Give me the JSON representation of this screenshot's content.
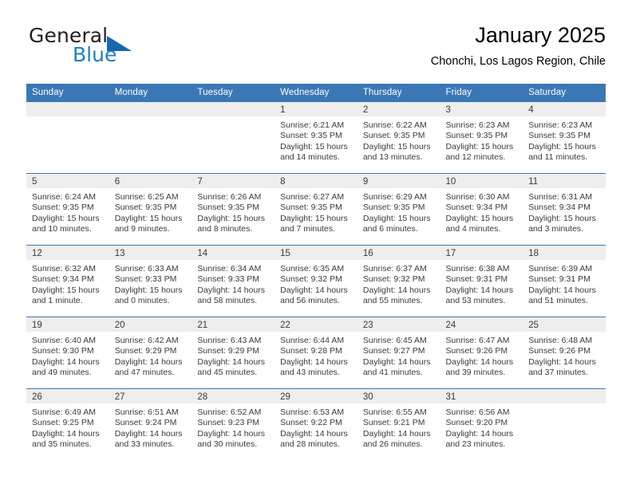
{
  "brand": {
    "name_part1": "General",
    "name_part2": "Blue",
    "triangle_color": "#1668b0",
    "blue_color": "#1f7fc4"
  },
  "header": {
    "title": "January 2025",
    "subtitle": "Chonchi, Los Lagos Region, Chile"
  },
  "theme": {
    "header_bg": "#3b77b5",
    "header_text": "#ffffff",
    "daynum_band_bg": "#eeeeee",
    "cell_text": "#3a3a3a",
    "row_border": "#3b77b5"
  },
  "weekday_headers": [
    "Sunday",
    "Monday",
    "Tuesday",
    "Wednesday",
    "Thursday",
    "Friday",
    "Saturday"
  ],
  "labels": {
    "sunrise_prefix": "Sunrise:",
    "sunset_prefix": "Sunset:",
    "daylight_prefix": "Daylight:"
  },
  "weeks": [
    [
      {
        "day": "",
        "sunrise": "",
        "sunset": "",
        "daylight": ""
      },
      {
        "day": "",
        "sunrise": "",
        "sunset": "",
        "daylight": ""
      },
      {
        "day": "",
        "sunrise": "",
        "sunset": "",
        "daylight": ""
      },
      {
        "day": "1",
        "sunrise": "Sunrise: 6:21 AM",
        "sunset": "Sunset: 9:35 PM",
        "daylight": "Daylight: 15 hours and 14 minutes."
      },
      {
        "day": "2",
        "sunrise": "Sunrise: 6:22 AM",
        "sunset": "Sunset: 9:35 PM",
        "daylight": "Daylight: 15 hours and 13 minutes."
      },
      {
        "day": "3",
        "sunrise": "Sunrise: 6:23 AM",
        "sunset": "Sunset: 9:35 PM",
        "daylight": "Daylight: 15 hours and 12 minutes."
      },
      {
        "day": "4",
        "sunrise": "Sunrise: 6:23 AM",
        "sunset": "Sunset: 9:35 PM",
        "daylight": "Daylight: 15 hours and 11 minutes."
      }
    ],
    [
      {
        "day": "5",
        "sunrise": "Sunrise: 6:24 AM",
        "sunset": "Sunset: 9:35 PM",
        "daylight": "Daylight: 15 hours and 10 minutes."
      },
      {
        "day": "6",
        "sunrise": "Sunrise: 6:25 AM",
        "sunset": "Sunset: 9:35 PM",
        "daylight": "Daylight: 15 hours and 9 minutes."
      },
      {
        "day": "7",
        "sunrise": "Sunrise: 6:26 AM",
        "sunset": "Sunset: 9:35 PM",
        "daylight": "Daylight: 15 hours and 8 minutes."
      },
      {
        "day": "8",
        "sunrise": "Sunrise: 6:27 AM",
        "sunset": "Sunset: 9:35 PM",
        "daylight": "Daylight: 15 hours and 7 minutes."
      },
      {
        "day": "9",
        "sunrise": "Sunrise: 6:29 AM",
        "sunset": "Sunset: 9:35 PM",
        "daylight": "Daylight: 15 hours and 6 minutes."
      },
      {
        "day": "10",
        "sunrise": "Sunrise: 6:30 AM",
        "sunset": "Sunset: 9:34 PM",
        "daylight": "Daylight: 15 hours and 4 minutes."
      },
      {
        "day": "11",
        "sunrise": "Sunrise: 6:31 AM",
        "sunset": "Sunset: 9:34 PM",
        "daylight": "Daylight: 15 hours and 3 minutes."
      }
    ],
    [
      {
        "day": "12",
        "sunrise": "Sunrise: 6:32 AM",
        "sunset": "Sunset: 9:34 PM",
        "daylight": "Daylight: 15 hours and 1 minute."
      },
      {
        "day": "13",
        "sunrise": "Sunrise: 6:33 AM",
        "sunset": "Sunset: 9:33 PM",
        "daylight": "Daylight: 15 hours and 0 minutes."
      },
      {
        "day": "14",
        "sunrise": "Sunrise: 6:34 AM",
        "sunset": "Sunset: 9:33 PM",
        "daylight": "Daylight: 14 hours and 58 minutes."
      },
      {
        "day": "15",
        "sunrise": "Sunrise: 6:35 AM",
        "sunset": "Sunset: 9:32 PM",
        "daylight": "Daylight: 14 hours and 56 minutes."
      },
      {
        "day": "16",
        "sunrise": "Sunrise: 6:37 AM",
        "sunset": "Sunset: 9:32 PM",
        "daylight": "Daylight: 14 hours and 55 minutes."
      },
      {
        "day": "17",
        "sunrise": "Sunrise: 6:38 AM",
        "sunset": "Sunset: 9:31 PM",
        "daylight": "Daylight: 14 hours and 53 minutes."
      },
      {
        "day": "18",
        "sunrise": "Sunrise: 6:39 AM",
        "sunset": "Sunset: 9:31 PM",
        "daylight": "Daylight: 14 hours and 51 minutes."
      }
    ],
    [
      {
        "day": "19",
        "sunrise": "Sunrise: 6:40 AM",
        "sunset": "Sunset: 9:30 PM",
        "daylight": "Daylight: 14 hours and 49 minutes."
      },
      {
        "day": "20",
        "sunrise": "Sunrise: 6:42 AM",
        "sunset": "Sunset: 9:29 PM",
        "daylight": "Daylight: 14 hours and 47 minutes."
      },
      {
        "day": "21",
        "sunrise": "Sunrise: 6:43 AM",
        "sunset": "Sunset: 9:29 PM",
        "daylight": "Daylight: 14 hours and 45 minutes."
      },
      {
        "day": "22",
        "sunrise": "Sunrise: 6:44 AM",
        "sunset": "Sunset: 9:28 PM",
        "daylight": "Daylight: 14 hours and 43 minutes."
      },
      {
        "day": "23",
        "sunrise": "Sunrise: 6:45 AM",
        "sunset": "Sunset: 9:27 PM",
        "daylight": "Daylight: 14 hours and 41 minutes."
      },
      {
        "day": "24",
        "sunrise": "Sunrise: 6:47 AM",
        "sunset": "Sunset: 9:26 PM",
        "daylight": "Daylight: 14 hours and 39 minutes."
      },
      {
        "day": "25",
        "sunrise": "Sunrise: 6:48 AM",
        "sunset": "Sunset: 9:26 PM",
        "daylight": "Daylight: 14 hours and 37 minutes."
      }
    ],
    [
      {
        "day": "26",
        "sunrise": "Sunrise: 6:49 AM",
        "sunset": "Sunset: 9:25 PM",
        "daylight": "Daylight: 14 hours and 35 minutes."
      },
      {
        "day": "27",
        "sunrise": "Sunrise: 6:51 AM",
        "sunset": "Sunset: 9:24 PM",
        "daylight": "Daylight: 14 hours and 33 minutes."
      },
      {
        "day": "28",
        "sunrise": "Sunrise: 6:52 AM",
        "sunset": "Sunset: 9:23 PM",
        "daylight": "Daylight: 14 hours and 30 minutes."
      },
      {
        "day": "29",
        "sunrise": "Sunrise: 6:53 AM",
        "sunset": "Sunset: 9:22 PM",
        "daylight": "Daylight: 14 hours and 28 minutes."
      },
      {
        "day": "30",
        "sunrise": "Sunrise: 6:55 AM",
        "sunset": "Sunset: 9:21 PM",
        "daylight": "Daylight: 14 hours and 26 minutes."
      },
      {
        "day": "31",
        "sunrise": "Sunrise: 6:56 AM",
        "sunset": "Sunset: 9:20 PM",
        "daylight": "Daylight: 14 hours and 23 minutes."
      },
      {
        "day": "",
        "sunrise": "",
        "sunset": "",
        "daylight": ""
      }
    ]
  ]
}
